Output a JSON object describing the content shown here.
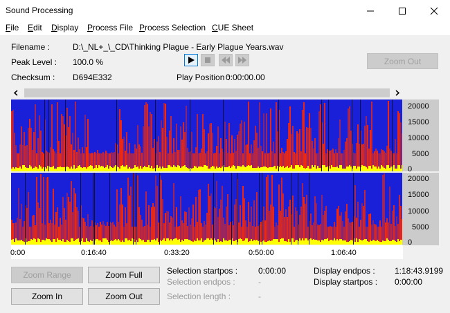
{
  "window": {
    "title": "Sound Processing"
  },
  "menu": [
    {
      "key": "F",
      "rest": "ile"
    },
    {
      "key": "E",
      "rest": "dit"
    },
    {
      "key": "D",
      "rest": "isplay"
    },
    {
      "key": "P",
      "rest": "rocess File"
    },
    {
      "key": "P",
      "rest": "rocess Selection"
    },
    {
      "key": "C",
      "rest": "UE Sheet"
    }
  ],
  "info": {
    "filename_label": "Filename :",
    "filename_value": "D:\\_NL+_\\_CD\\Thinking Plague - Early Plague Years.wav",
    "peak_label": "Peak Level :",
    "peak_value": "100.0 %",
    "checksum_label": "Checksum :",
    "checksum_value": "D694E332",
    "playpos_label": "Play Position :",
    "playpos_value": "0:00:00.00"
  },
  "buttons": {
    "zoom_out_top": "Zoom Out",
    "zoom_range": "Zoom Range",
    "zoom_full": "Zoom Full",
    "zoom_in": "Zoom In",
    "zoom_out": "Zoom Out"
  },
  "icons": {
    "play": "play-icon",
    "stop": "stop-icon",
    "rewind": "rewind-icon",
    "fast_forward": "fast-forward-icon",
    "scroll_left": "chevron-left-icon",
    "scroll_right": "chevron-right-icon"
  },
  "spectrogram": {
    "y_ticks": [
      "20000",
      "15000",
      "10000",
      "5000",
      "0"
    ],
    "time_ticks": [
      "0:00",
      "0:16:40",
      "0:33:20",
      "0:50:00",
      "1:06:40"
    ]
  },
  "selection": {
    "start_label": "Selection startpos :",
    "start_value": "0:00:00",
    "end_label": "Selection endpos :",
    "end_value": "-",
    "length_label": "Selection length :",
    "length_value": "-"
  },
  "display": {
    "endpos_label": "Display endpos :",
    "endpos_value": "1:18:43.9199",
    "startpos_label": "Display startpos :",
    "startpos_value": "0:00:00"
  },
  "colors": {
    "spectrum_base": "#1a1fd8",
    "spectrum_hot": "#ff2a00",
    "spectrum_peak": "#ffff00"
  }
}
